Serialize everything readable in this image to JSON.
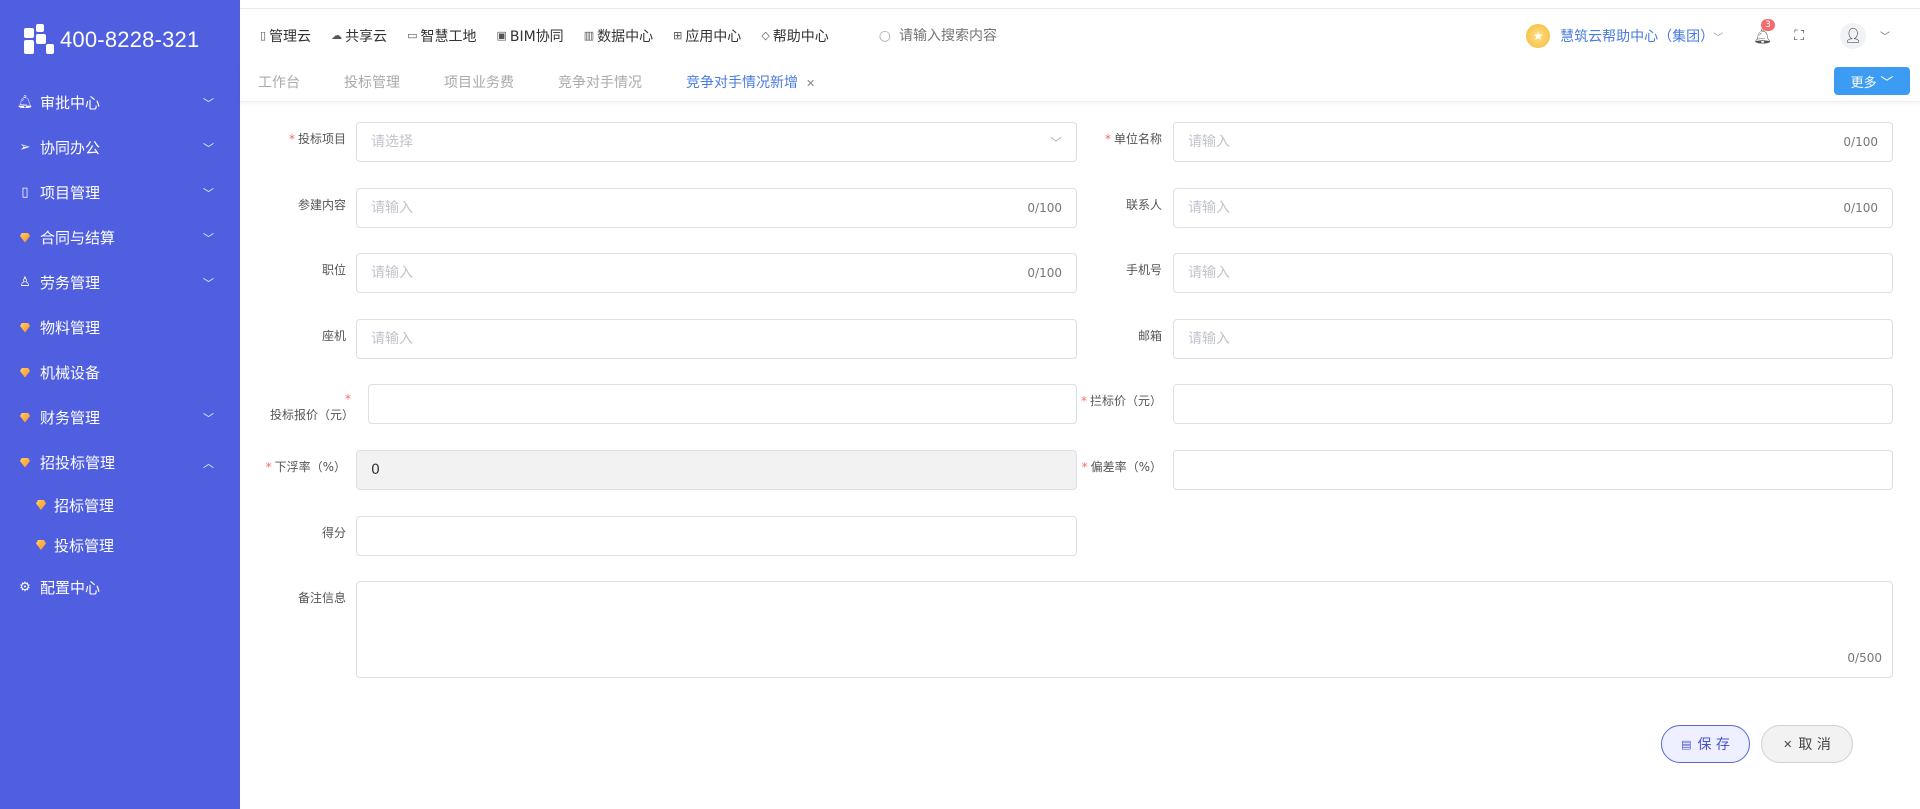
{
  "brand": {
    "phone": "400-8228-321"
  },
  "sidebar": {
    "items": [
      {
        "icon": "bell-icon",
        "glyph": "🔔",
        "label": "审批中心",
        "chevron": "﹀"
      },
      {
        "icon": "send-icon",
        "glyph": "➢",
        "label": "协同办公",
        "chevron": "﹀"
      },
      {
        "icon": "book-icon",
        "glyph": "▯",
        "label": "项目管理",
        "chevron": "﹀"
      },
      {
        "icon": "gem-icon",
        "glyph": "",
        "label": "合同与结算",
        "chevron": "﹀"
      },
      {
        "icon": "user-icon",
        "glyph": "♙",
        "label": "劳务管理",
        "chevron": "﹀"
      },
      {
        "icon": "gem-icon",
        "glyph": "",
        "label": "物料管理",
        "chevron": ""
      },
      {
        "icon": "gem-icon",
        "glyph": "",
        "label": "机械设备",
        "chevron": ""
      },
      {
        "icon": "gem-icon",
        "glyph": "",
        "label": "财务管理",
        "chevron": "﹀"
      },
      {
        "icon": "gem-icon",
        "glyph": "",
        "label": "招投标管理",
        "chevron": "︿"
      }
    ],
    "subitems": [
      {
        "label": "招标管理"
      },
      {
        "label": "投标管理"
      }
    ],
    "config": {
      "label": "配置中心"
    }
  },
  "topnav": {
    "items": [
      {
        "label": "管理云"
      },
      {
        "label": "共享云"
      },
      {
        "label": "智慧工地"
      },
      {
        "label": "BIM协同"
      },
      {
        "label": "数据中心"
      },
      {
        "label": "应用中心"
      },
      {
        "label": "帮助中心"
      }
    ],
    "search_placeholder": "请输入搜索内容",
    "help_center": "慧筑云帮助中心（集团）",
    "notification_count": "3"
  },
  "tabs": {
    "items": [
      {
        "label": "工作台"
      },
      {
        "label": "投标管理"
      },
      {
        "label": "项目业务费"
      },
      {
        "label": "竞争对手情况"
      },
      {
        "label": "竞争对手情况新增"
      }
    ],
    "more": "更多"
  },
  "form": {
    "bid_project": {
      "label": "投标项目",
      "placeholder": "请选择"
    },
    "unit_name": {
      "label": "单位名称",
      "placeholder": "请输入",
      "count": "0/100"
    },
    "participation": {
      "label": "参建内容",
      "placeholder": "请输入",
      "count": "0/100"
    },
    "contact": {
      "label": "联系人",
      "placeholder": "请输入",
      "count": "0/100"
    },
    "position": {
      "label": "职位",
      "placeholder": "请输入",
      "count": "0/100"
    },
    "mobile": {
      "label": "手机号",
      "placeholder": "请输入"
    },
    "landline": {
      "label": "座机",
      "placeholder": "请输入"
    },
    "email": {
      "label": "邮箱",
      "placeholder": "请输入"
    },
    "bid_price": {
      "label": "投标报价（元）"
    },
    "ceiling_price": {
      "label": "拦标价（元）"
    },
    "float_rate": {
      "label": "下浮率（%）",
      "value": "0"
    },
    "deviation_rate": {
      "label": "偏差率（%）"
    },
    "score": {
      "label": "得分"
    },
    "remarks": {
      "label": "备注信息",
      "count": "0/500"
    }
  },
  "actions": {
    "save": "保 存",
    "cancel": "取 消"
  }
}
